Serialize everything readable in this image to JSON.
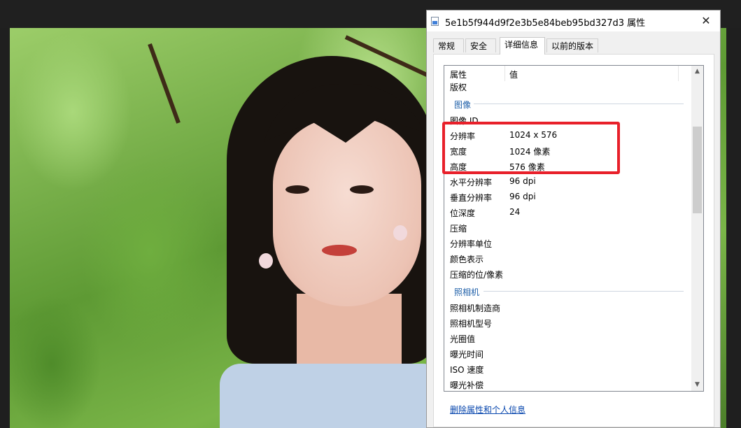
{
  "window": {
    "title": "5e1b5f944d9f2e3b5e84beb95bd327d3 属性",
    "close_glyph": "✕"
  },
  "tabs": [
    {
      "label": "常规",
      "active": false
    },
    {
      "label": "安全",
      "active": false
    },
    {
      "label": "详细信息",
      "active": true
    },
    {
      "label": "以前的版本",
      "active": false
    }
  ],
  "list": {
    "headers": {
      "property": "属性",
      "value": "值"
    },
    "rows_top": [
      {
        "key": "版权",
        "value": ""
      }
    ],
    "section_image": "图像",
    "image_rows": [
      {
        "key": "图像 ID",
        "value": ""
      },
      {
        "key": "分辨率",
        "value": "1024 x 576"
      },
      {
        "key": "宽度",
        "value": "1024 像素"
      },
      {
        "key": "高度",
        "value": "576 像素"
      },
      {
        "key": "水平分辨率",
        "value": "96 dpi"
      },
      {
        "key": "垂直分辨率",
        "value": "96 dpi"
      },
      {
        "key": "位深度",
        "value": "24"
      },
      {
        "key": "压缩",
        "value": ""
      },
      {
        "key": "分辨率单位",
        "value": ""
      },
      {
        "key": "颜色表示",
        "value": ""
      },
      {
        "key": "压缩的位/像素",
        "value": ""
      }
    ],
    "section_camera": "照相机",
    "camera_rows": [
      {
        "key": "照相机制造商",
        "value": ""
      },
      {
        "key": "照相机型号",
        "value": ""
      },
      {
        "key": "光圈值",
        "value": ""
      },
      {
        "key": "曝光时间",
        "value": ""
      },
      {
        "key": "ISO 速度",
        "value": ""
      },
      {
        "key": "曝光补偿",
        "value": ""
      }
    ],
    "scroll_up_glyph": "▲",
    "scroll_down_glyph": "▼"
  },
  "remove_link": "删除属性和个人信息",
  "colors": {
    "highlight": "#e8202a",
    "section_label": "#1e5fa8",
    "link": "#0645ad"
  }
}
